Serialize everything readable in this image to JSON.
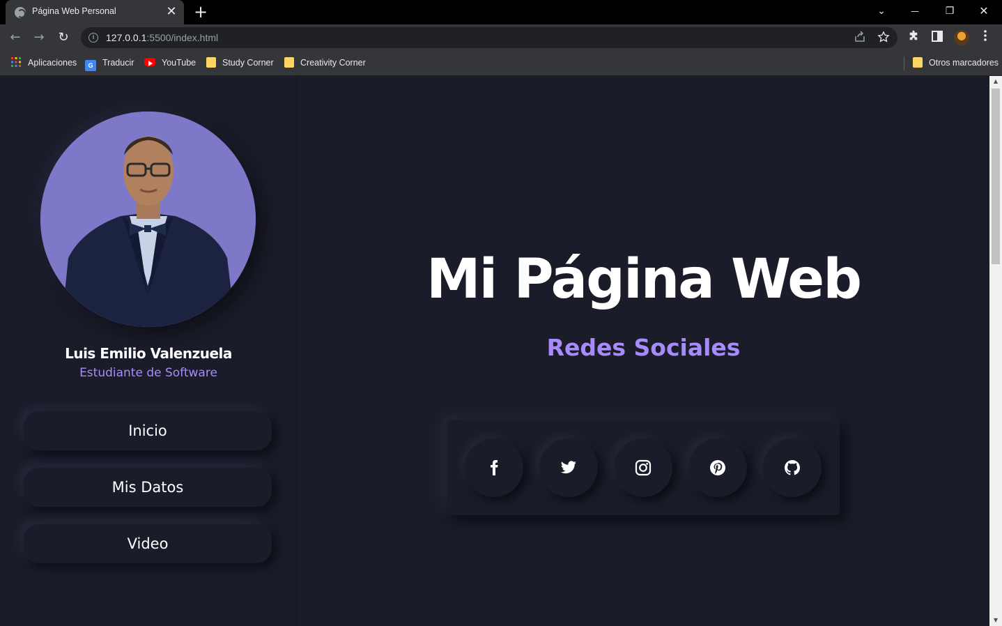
{
  "browser": {
    "tab_title": "Página Web Personal",
    "tab_close": "✕",
    "new_tab": "+",
    "url_host": "127.0.0.1",
    "url_path": ":5500/index.html",
    "window_controls": {
      "dropdown": "⌄",
      "minimize": "—",
      "restore": "❐",
      "close": "✕"
    },
    "nav": {
      "back": "←",
      "forward": "→",
      "reload": "↻"
    }
  },
  "bookmarks": [
    {
      "label": "Aplicaciones",
      "icon": "apps-grid-icon"
    },
    {
      "label": "Traducir",
      "icon": "google-translate-icon"
    },
    {
      "label": "YouTube",
      "icon": "youtube-icon"
    },
    {
      "label": "Study Corner",
      "icon": "folder-icon"
    },
    {
      "label": "Creativity Corner",
      "icon": "folder-icon"
    }
  ],
  "other_bookmarks": "Otros marcadores",
  "profile": {
    "name": "Luis Emilio Valenzuela",
    "role": "Estudiante de Software"
  },
  "sidebar_nav": [
    {
      "label": "Inicio"
    },
    {
      "label": "Mis Datos"
    },
    {
      "label": "Video"
    }
  ],
  "main": {
    "title": "Mi Página Web",
    "subtitle": "Redes Sociales"
  },
  "social_links": [
    {
      "icon": "facebook-icon"
    },
    {
      "icon": "twitter-icon"
    },
    {
      "icon": "instagram-icon"
    },
    {
      "icon": "pinterest-icon"
    },
    {
      "icon": "github-icon"
    }
  ],
  "colors": {
    "page_bg": "#1b1c29",
    "accent": "#a78bfa",
    "photo_bg": "#7e78c9"
  }
}
